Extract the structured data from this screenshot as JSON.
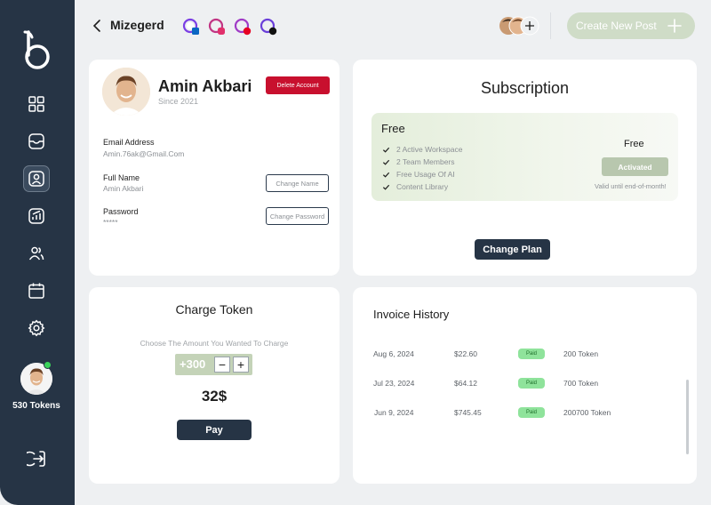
{
  "colors": {
    "sidebar_bg": "#263445",
    "accent_green": "#cfdcc7",
    "danger": "#c8102e",
    "paid_badge": "#8fe39b"
  },
  "sidebar": {
    "logo_icon": "b-logo-icon",
    "items": [
      {
        "name": "dashboard",
        "icon": "grid-icon",
        "active": false
      },
      {
        "name": "inbox",
        "icon": "inbox-icon",
        "active": false
      },
      {
        "name": "profile",
        "icon": "user-icon",
        "active": true
      },
      {
        "name": "analytics",
        "icon": "chart-icon",
        "active": false
      },
      {
        "name": "team",
        "icon": "users-icon",
        "active": false
      },
      {
        "name": "calendar",
        "icon": "calendar-icon",
        "active": false
      },
      {
        "name": "settings",
        "icon": "gear-icon",
        "active": false
      }
    ],
    "tokens_label": "530 Tokens",
    "logout_icon": "logout-icon"
  },
  "header": {
    "brand_name": "Mizegerd",
    "social_accounts": [
      "linkedin",
      "instagram",
      "pinterest",
      "tiktok"
    ],
    "create_button_label": "Create New Post"
  },
  "profile": {
    "name": "Amin Akbari",
    "since": "Since 2021",
    "delete_label": "Delete Account",
    "email_label": "Email Address",
    "email_value": "Amin.76ak@Gmail.Com",
    "fullname_label": "Full Name",
    "fullname_value": "Amin Akbari",
    "change_name_label": "Change Name",
    "password_label": "Password",
    "password_value": "*****",
    "change_password_label": "Change Password"
  },
  "subscription": {
    "title": "Subscription",
    "plan_name": "Free",
    "features": [
      "2 Active Workspace",
      "2 Team Members",
      "Free Usage Of AI",
      "Content Library"
    ],
    "price": "Free",
    "status_label": "Activated",
    "valid_text": "Valid until end-of-month!",
    "change_plan_label": "Change Plan"
  },
  "charge_token": {
    "title": "Charge Token",
    "hint": "Choose The Amount You Wanted To Charge",
    "amount": "+300",
    "minus": "−",
    "plus": "+",
    "price": "32$",
    "pay_label": "Pay"
  },
  "invoice": {
    "title": "Invoice History",
    "rows": [
      {
        "date": "Aug 6, 2024",
        "amount": "$22.60",
        "status": "Paid",
        "tokens": "200 Token"
      },
      {
        "date": "Jul 23, 2024",
        "amount": "$64.12",
        "status": "Paid",
        "tokens": "700 Token"
      },
      {
        "date": "Jun 9, 2024",
        "amount": "$745.45",
        "status": "Paid",
        "tokens": "200700 Token"
      }
    ]
  }
}
